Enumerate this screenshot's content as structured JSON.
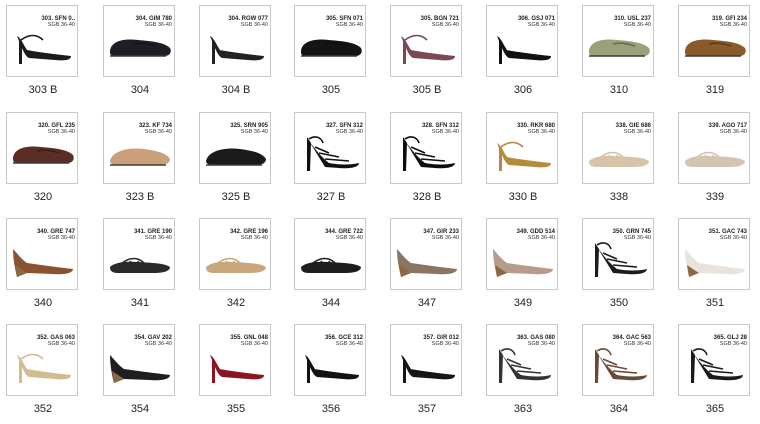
{
  "catalog": {
    "items": [
      {
        "label": "303 B",
        "code": "303. SFN 0..",
        "size": "SGB 36-40",
        "color": "#1b1b1b",
        "style": "strap"
      },
      {
        "label": "304",
        "code": "304. GIM 780",
        "size": "SGB 36-40",
        "color": "#1d1f24",
        "style": "loafer"
      },
      {
        "label": "304 B",
        "code": "304. RGW 077",
        "size": "SGB 36-40",
        "color": "#222222",
        "style": "pump"
      },
      {
        "label": "305",
        "code": "305. SFN 071",
        "size": "SGB 36-40",
        "color": "#141414",
        "style": "loafer"
      },
      {
        "label": "305 B",
        "code": "305. BGN 721",
        "size": "SGB 36-40",
        "color": "#7a4a52",
        "style": "strap"
      },
      {
        "label": "306",
        "code": "306. GSJ 071",
        "size": "SGB 36-40",
        "color": "#111111",
        "style": "pump"
      },
      {
        "label": "310",
        "code": "310. USL 237",
        "size": "SGB 36-40",
        "color": "#9aa07a",
        "style": "loafer"
      },
      {
        "label": "319",
        "code": "319. GFI 234",
        "size": "SGB 36-40",
        "color": "#8a5a2b",
        "style": "loafer"
      },
      {
        "label": "320",
        "code": "320. GFL 235",
        "size": "SGB 36-40",
        "color": "#5a2e24",
        "style": "loafer"
      },
      {
        "label": "323 B",
        "code": "323. KF 734",
        "size": "SGB 36-40",
        "color": "#c9a07a",
        "style": "mule"
      },
      {
        "label": "325 B",
        "code": "325. SRN 905",
        "size": "SGB 36-40",
        "color": "#1a1a1a",
        "style": "mule"
      },
      {
        "label": "327 B",
        "code": "327. SFN 312",
        "size": "SGB 36-40",
        "color": "#111111",
        "style": "sandal"
      },
      {
        "label": "328 B",
        "code": "328. SFN 312",
        "size": "SGB 36-40",
        "color": "#0d0d0d",
        "style": "sandal"
      },
      {
        "label": "330 B",
        "code": "330. RKR 680",
        "size": "SGB 36-40",
        "color": "#b38b3b",
        "style": "strap"
      },
      {
        "label": "338",
        "code": "338. GIE 686",
        "size": "SGB 36-40",
        "color": "#d8c2a8",
        "style": "flat"
      },
      {
        "label": "339",
        "code": "339. AGO 717",
        "size": "SGB 36-40",
        "color": "#d3c4b2",
        "style": "flat"
      },
      {
        "label": "340",
        "code": "340. GRE 747",
        "size": "SGB 36-40",
        "color": "#8a5230",
        "style": "wedge"
      },
      {
        "label": "341",
        "code": "341. GRE 190",
        "size": "SGB 36-40",
        "color": "#2a2a2a",
        "style": "flat"
      },
      {
        "label": "342",
        "code": "342. GRE 196",
        "size": "SGB 36-40",
        "color": "#c9a77a",
        "style": "flat"
      },
      {
        "label": "344",
        "code": "344. GRE 722",
        "size": "SGB 36-40",
        "color": "#1e1e1e",
        "style": "flat"
      },
      {
        "label": "347",
        "code": "347. GIR 233",
        "size": "SGB 36-40",
        "color": "#8a7660",
        "style": "wedge"
      },
      {
        "label": "349",
        "code": "349. GDD 514",
        "size": "SGB 36-40",
        "color": "#b89b8a",
        "style": "wedge"
      },
      {
        "label": "350",
        "code": "350. GRN 745",
        "size": "SGB 36-40",
        "color": "#1c1c1c",
        "style": "sandal"
      },
      {
        "label": "351",
        "code": "351. GAC 743",
        "size": "SGB 36-40",
        "color": "#e9e4da",
        "style": "wedge"
      },
      {
        "label": "352",
        "code": "352. GAS 063",
        "size": "SGB 36-40",
        "color": "#d2bb90",
        "style": "strap"
      },
      {
        "label": "354",
        "code": "354. GAV 202",
        "size": "SGB 36-40",
        "color": "#1e1e1e",
        "style": "wedge"
      },
      {
        "label": "355",
        "code": "355. GNL 048",
        "size": "SGB 36-40",
        "color": "#8b1420",
        "style": "pump"
      },
      {
        "label": "356",
        "code": "356. GCE 312",
        "size": "SGB 36-40",
        "color": "#111111",
        "style": "pump"
      },
      {
        "label": "357",
        "code": "357. GIR 012",
        "size": "SGB 36-40",
        "color": "#161616",
        "style": "pump"
      },
      {
        "label": "363",
        "code": "363. GAS 080",
        "size": "SGB 36-40",
        "color": "#333333",
        "style": "sandal"
      },
      {
        "label": "364",
        "code": "364. GAC 563",
        "size": "SGB 36-40",
        "color": "#6a4a36",
        "style": "sandal"
      },
      {
        "label": "365",
        "code": "365. GLJ 28",
        "size": "SGB 36-40",
        "color": "#1a1a1a",
        "style": "sandal"
      }
    ]
  }
}
